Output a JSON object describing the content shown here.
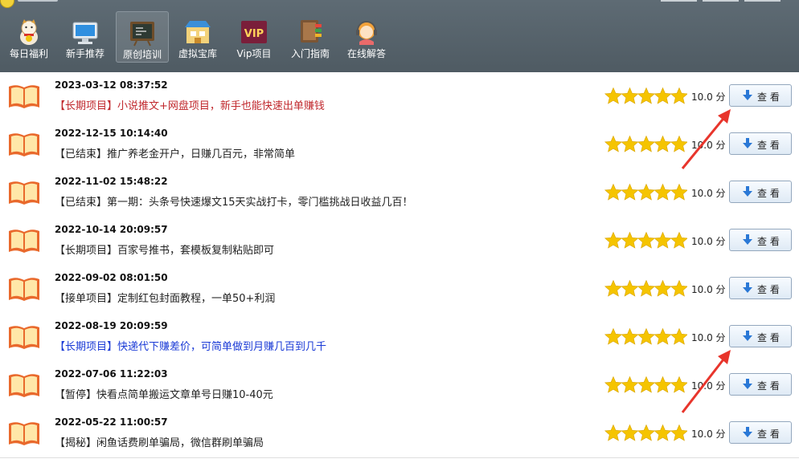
{
  "nav": {
    "items": [
      {
        "label": "每日福利",
        "icon": "lucky-cat-icon"
      },
      {
        "label": "新手推荐",
        "icon": "monitor-icon"
      },
      {
        "label": "原创培训",
        "icon": "blackboard-icon"
      },
      {
        "label": "虚拟宝库",
        "icon": "store-icon"
      },
      {
        "label": "Vip项目",
        "icon": "vip-icon"
      },
      {
        "label": "入门指南",
        "icon": "book-stack-icon"
      },
      {
        "label": "在线解答",
        "icon": "support-agent-icon"
      }
    ],
    "active_index": 2
  },
  "list": {
    "rows": [
      {
        "date": "2023-03-12 08:37:52",
        "title": "【长期项目】小说推文+网盘项目，新手也能快速出单赚钱",
        "title_color": "#c0282d",
        "rating": 5,
        "score": "10.0 分",
        "button": "查 看"
      },
      {
        "date": "2022-12-15 10:14:40",
        "title": "【已结束】推广养老金开户，日赚几百元，非常简单",
        "title_color": "#222222",
        "rating": 5,
        "score": "10.0 分",
        "button": "查 看"
      },
      {
        "date": "2022-11-02 15:48:22",
        "title": "【已结束】第一期：头条号快速爆文15天实战打卡，零门槛挑战日收益几百！",
        "title_color": "#222222",
        "rating": 5,
        "score": "10.0 分",
        "button": "查 看"
      },
      {
        "date": "2022-10-14 20:09:57",
        "title": "【长期项目】百家号推书，套模板复制粘贴即可",
        "title_color": "#222222",
        "rating": 5,
        "score": "10.0 分",
        "button": "查 看"
      },
      {
        "date": "2022-09-02 08:01:50",
        "title": "【接单项目】定制红包封面教程，一单50+利润",
        "title_color": "#222222",
        "rating": 5,
        "score": "10.0 分",
        "button": "查 看"
      },
      {
        "date": "2022-08-19 20:09:59",
        "title": "【长期项目】快递代下赚差价，可简单做到月赚几百到几千",
        "title_color": "#1a3ad6",
        "rating": 5,
        "score": "10.0 分",
        "button": "查 看"
      },
      {
        "date": "2022-07-06 11:22:03",
        "title": "【暂停】快看点简单搬运文章单号日赚10-40元",
        "title_color": "#222222",
        "rating": 5,
        "score": "10.0 分",
        "button": "查 看"
      },
      {
        "date": "2022-05-22 11:00:57",
        "title": "【揭秘】闲鱼话费刷单骗局，微信群刷单骗局",
        "title_color": "#222222",
        "rating": 5,
        "score": "10.0 分",
        "button": "查 看"
      }
    ]
  },
  "colors": {
    "star": "#f5c400",
    "arrow": "#e8352c",
    "book": "#e9692c"
  }
}
